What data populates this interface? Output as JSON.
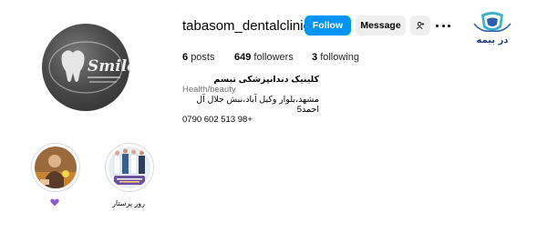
{
  "profile": {
    "username": "tabasom_dentalclinic_",
    "avatar_logo_text": "Smile",
    "avatar_icon": "tooth-logo-icon",
    "brand_logo_text": "در بیمه",
    "brand_logo_icon": "shield-logo-icon"
  },
  "actions": {
    "follow_label": "Follow",
    "message_label": "Message",
    "suggest_icon": "add-person-icon",
    "more_icon": "more-options-icon"
  },
  "stats": {
    "posts_count": "6",
    "posts_label": "posts",
    "followers_count": "649",
    "followers_label": "followers",
    "following_count": "3",
    "following_label": "following"
  },
  "bio": {
    "name": "کلینیک دندانپزشکی تبسم",
    "category": "Health/beauty",
    "address": "مشهد،بلوار وکیل آباد،نبش جلال آل احمد5",
    "phone": "0790 602 513 98+"
  },
  "highlights": [
    {
      "label": "",
      "label_icon": "purple-heart-icon"
    },
    {
      "label": "روز پرستار",
      "label_icon": ""
    }
  ],
  "colors": {
    "follow_button": "#0095f6",
    "secondary_button": "#efefef",
    "heart": "#8e5bd6",
    "logo_blue": "#2b5fae",
    "logo_teal": "#3bb2c9"
  }
}
